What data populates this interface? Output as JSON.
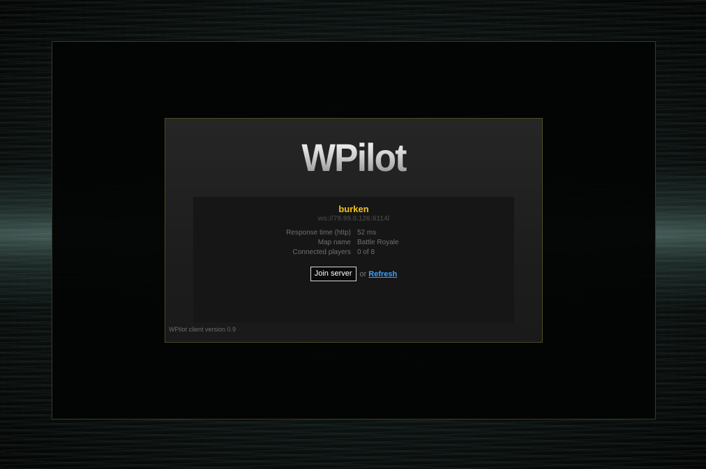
{
  "app": {
    "logo_text": "WPilot"
  },
  "server": {
    "name": "burken",
    "url": "ws://79.99.0.126:6114/",
    "info": [
      {
        "label": "Response time (http)",
        "value": "52 ms"
      },
      {
        "label": "Map name",
        "value": "Battle Royale"
      },
      {
        "label": "Connected players",
        "value": "0 of 8"
      }
    ]
  },
  "actions": {
    "join_label": "Join server",
    "or_text": "or",
    "refresh_label": "Refresh"
  },
  "footer": {
    "version_text": "WPilot client version 0.9"
  },
  "colors": {
    "server_name": "#f2c21a",
    "link": "#3aa0ff",
    "frame_border": "#4d4a22"
  }
}
